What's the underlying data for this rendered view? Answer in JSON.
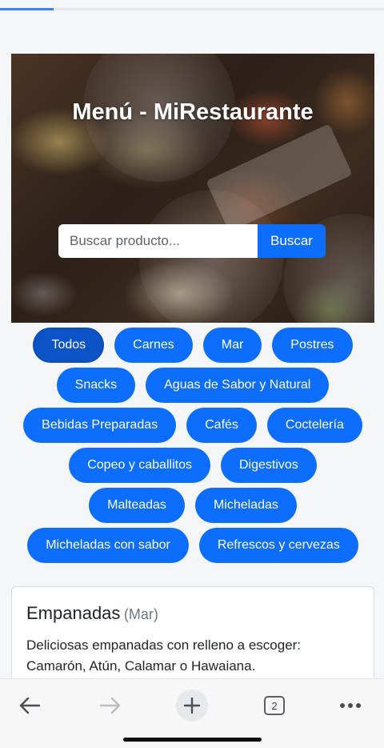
{
  "page_load": {
    "progress": 0.14
  },
  "hero": {
    "title": "Menú - MiRestaurante",
    "search": {
      "placeholder": "Buscar producto...",
      "value": "",
      "button_label": "Buscar"
    }
  },
  "categories": {
    "rows": [
      [
        {
          "label": "Todos",
          "active": true
        },
        {
          "label": "Carnes"
        },
        {
          "label": "Mar"
        },
        {
          "label": "Postres"
        }
      ],
      [
        {
          "label": "Snacks"
        },
        {
          "label": "Aguas de Sabor y Natural"
        }
      ],
      [
        {
          "label": "Bebidas Preparadas"
        },
        {
          "label": "Cafés"
        },
        {
          "label": "Coctelería"
        }
      ],
      [
        {
          "label": "Copeo y caballitos"
        },
        {
          "label": "Digestivos"
        }
      ],
      [
        {
          "label": "Malteadas"
        },
        {
          "label": "Micheladas"
        }
      ],
      [
        {
          "label": "Micheladas con sabor"
        },
        {
          "label": "Refrescos y cervezas"
        }
      ]
    ]
  },
  "product": {
    "name": "Empanadas",
    "category": "(Mar)",
    "description": "Deliciosas empanadas con relleno a escoger: Camarón, Atún, Calamar o Hawaiana."
  },
  "browser_toolbar": {
    "tab_count": "2",
    "icons": [
      "back-arrow-icon",
      "forward-arrow-icon",
      "plus-icon",
      "tabs-icon",
      "more-dots-icon"
    ]
  },
  "colors": {
    "accent": "#0d6efd",
    "accent_active": "#0b54c8",
    "page_background": "#f5f6f8"
  }
}
